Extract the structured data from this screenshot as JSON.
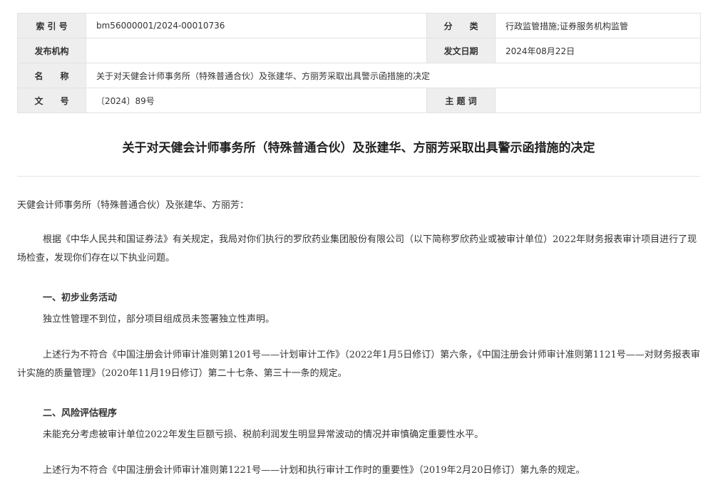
{
  "meta": {
    "index_label": "索 引 号",
    "index_value": "bm56000001/2024-00010736",
    "category_label": "分　　类",
    "category_value": "行政监管措施;证券服务机构监管",
    "issuer_label": "发布机构",
    "issuer_value": "",
    "date_label": "发文日期",
    "date_value": "2024年08月22日",
    "name_label": "名　　称",
    "name_value": "关于对天健会计师事务所（特殊普通合伙）及张建华、方丽芳采取出具警示函措施的决定",
    "docno_label": "文　　号",
    "docno_value": "〔2024〕89号",
    "keyword_label": "主 题 词",
    "keyword_value": ""
  },
  "document": {
    "title": "关于对天健会计师事务所（特殊普通合伙）及张建华、方丽芳采取出具警示函措施的决定",
    "salutation": "天健会计师事务所（特殊普通合伙）及张建华、方丽芳：",
    "para1": "根据《中华人民共和国证券法》有关规定，我局对你们执行的罗欣药业集团股份有限公司（以下简称罗欣药业或被审计单位）2022年财务报表审计项目进行了现场检查，发现你们存在以下执业问题。",
    "heading1": "一、初步业务活动",
    "para2": "独立性管理不到位，部分项目组成员未签署独立性声明。",
    "para3": "上述行为不符合《中国注册会计师审计准则第1201号——计划审计工作》（2022年1月5日修订）第六条，《中国注册会计师审计准则第1121号——对财务报表审计实施的质量管理》（2020年11月19日修订）第二十七条、第三十一条的规定。",
    "heading2": "二、风险评估程序",
    "para4": "未能充分考虑被审计单位2022年发生巨额亏损、税前利润发生明显异常波动的情况并审慎确定重要性水平。",
    "para5": "上述行为不符合《中国注册会计师审计准则第1221号——计划和执行审计工作时的重要性》（2019年2月20日修订）第九条的规定。"
  }
}
